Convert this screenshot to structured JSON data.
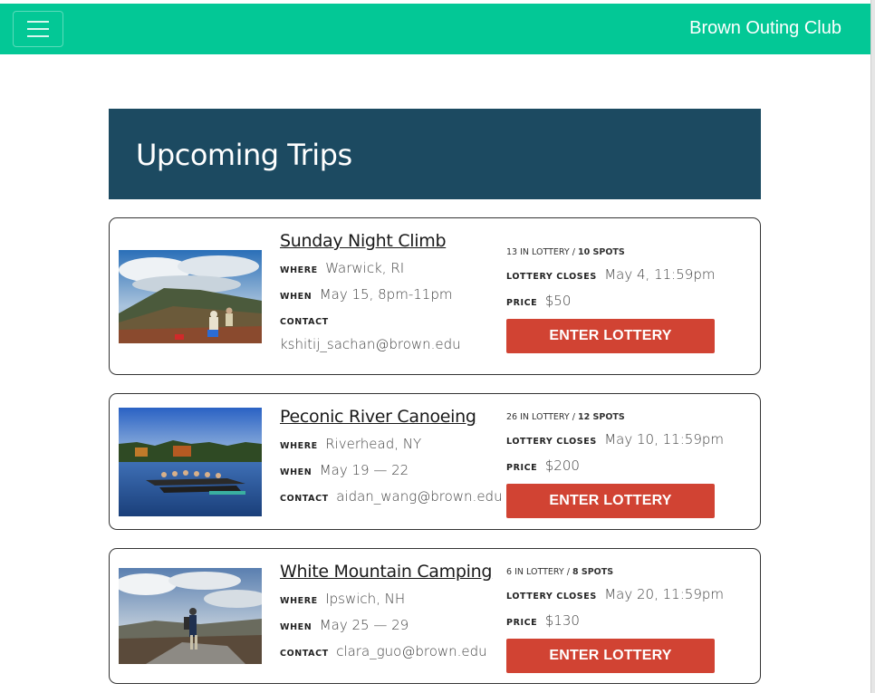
{
  "nav": {
    "brand": "Brown Outing Club",
    "menu_icon": "hamburger-menu-icon",
    "color": "#03c896"
  },
  "header": {
    "title": "Upcoming Trips",
    "color": "#1c4a61"
  },
  "labels": {
    "where": "WHERE",
    "when": "WHEN",
    "contact": "CONTACT",
    "lottery_closes": "LOTTERY CLOSES",
    "price": "PRICE",
    "in_lottery_suffix": "IN LOTTERY /",
    "enter": "ENTER LOTTERY"
  },
  "button_color": "#d14333",
  "trips": [
    {
      "title": "Sunday Night Climb",
      "where": "Warwick, RI",
      "when": "May 15, 8pm-11pm",
      "contact": "kshitij_sachan@brown.edu",
      "in_lottery": "13",
      "spots": "10 SPOTS",
      "lottery_closes": "May 4, 11:59pm",
      "price": "$50"
    },
    {
      "title": "Peconic River Canoeing",
      "where": "Riverhead, NY",
      "when": "May 19 — 22",
      "contact": "aidan_wang@brown.edu",
      "in_lottery": "26",
      "spots": "12 SPOTS",
      "lottery_closes": "May 10, 11:59pm",
      "price": "$200"
    },
    {
      "title": "White Mountain Camping",
      "where": "Ipswich, NH",
      "when": "May 25 — 29",
      "contact": "clara_guo@brown.edu",
      "in_lottery": "6",
      "spots": "8 SPOTS",
      "lottery_closes": "May 20, 11:59pm",
      "price": "$130"
    }
  ]
}
